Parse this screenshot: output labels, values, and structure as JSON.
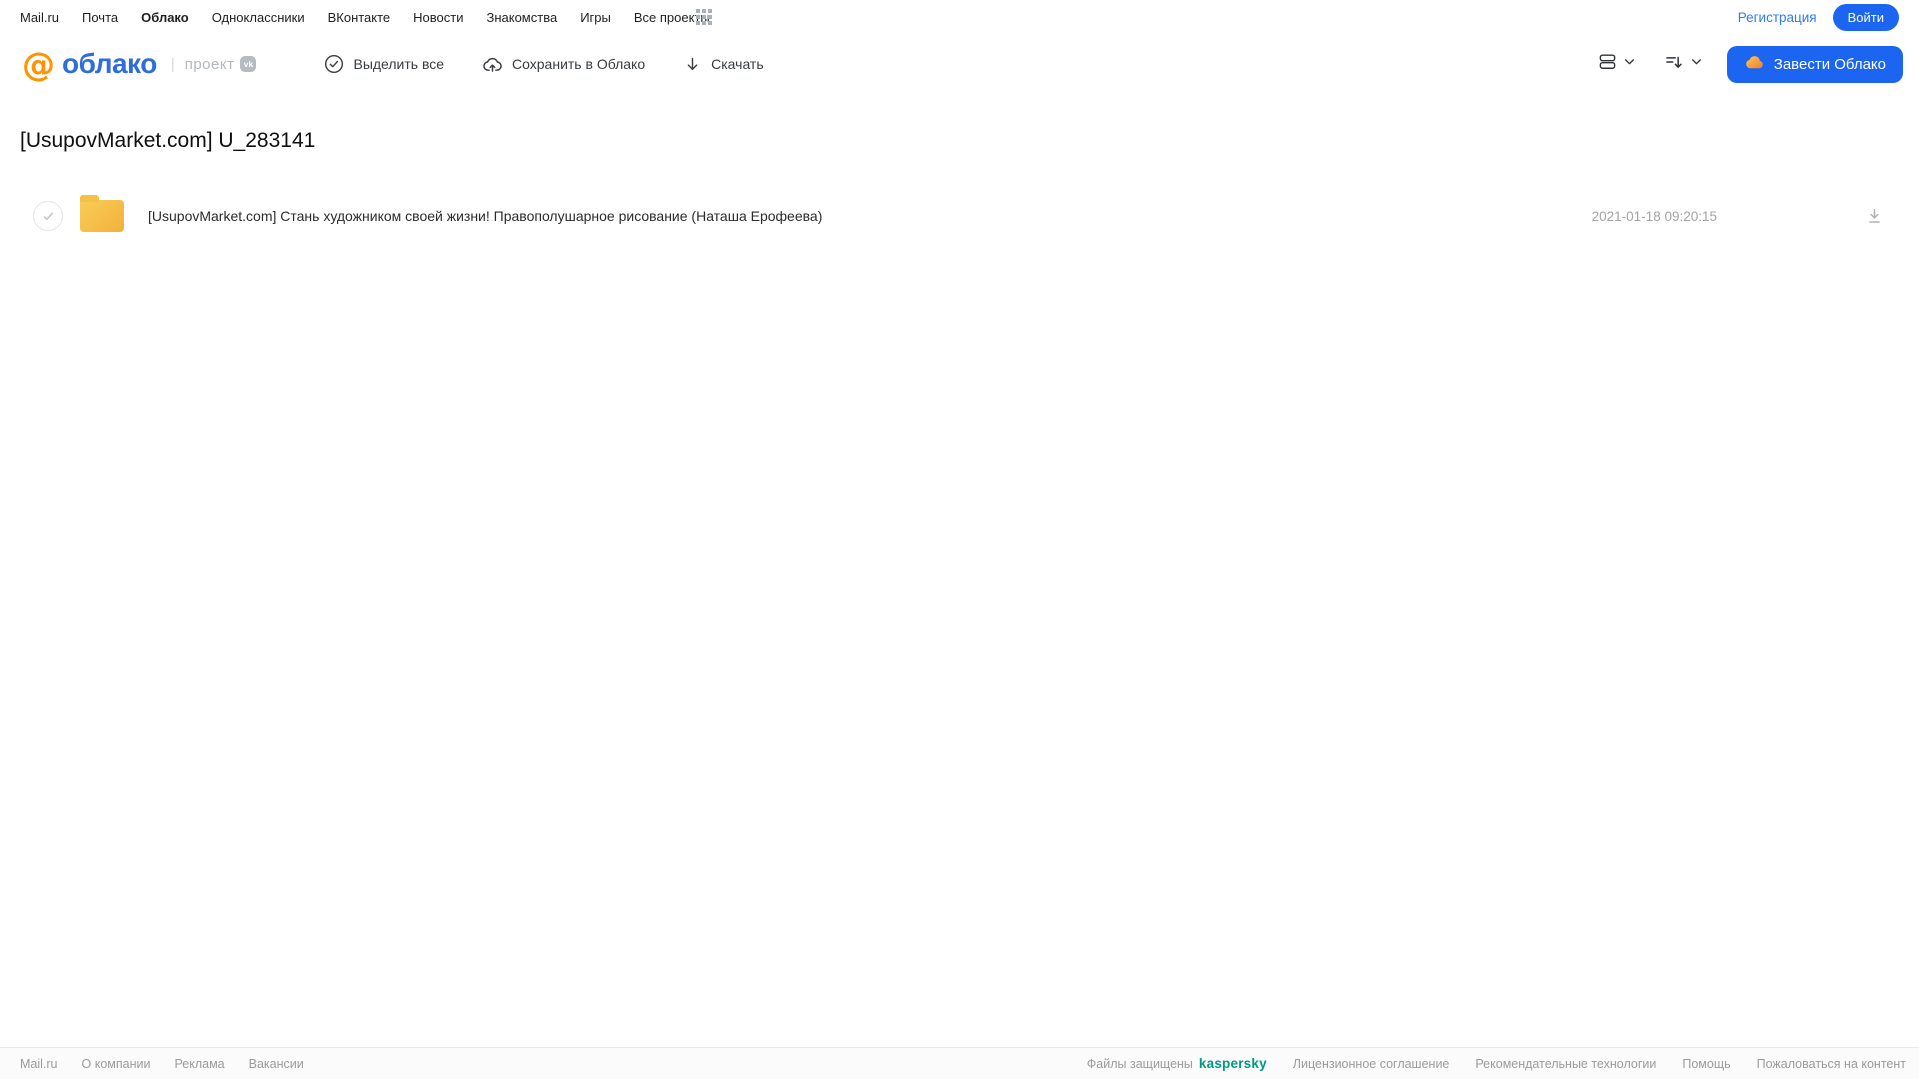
{
  "topnav": {
    "items": [
      "Mail.ru",
      "Почта",
      "Облако",
      "Одноклассники",
      "ВКонтакте",
      "Новости",
      "Знакомства",
      "Игры",
      "Все проекты"
    ],
    "register_label": "Регистрация",
    "login_label": "Войти"
  },
  "header": {
    "logo_at": "@",
    "logo_text": "облако",
    "logo_separator": "|",
    "project_label": "проект",
    "vk_badge_label": "vk",
    "toolbar": {
      "select_all_label": "Выделить все",
      "save_to_cloud_label": "Сохранить в Облако",
      "download_label": "Скачать"
    },
    "get_cloud_button_label": "Завести Облако"
  },
  "main": {
    "title": "[UsupovMarket.com] U_283141",
    "files": [
      {
        "name": "[UsupovMarket.com] Стань художником своей жизни! Правополушарное рисование (Наташа Ерофеева)",
        "date": "2021-01-18 09:20:15"
      }
    ]
  },
  "footer": {
    "left_links": [
      "Mail.ru",
      "О компании",
      "Реклама",
      "Вакансии"
    ],
    "protected_label": "Файлы защищены",
    "kaspersky_label": "kaspersky",
    "right_links": [
      "Лицензионное соглашение",
      "Рекомендательные технологии",
      "Помощь",
      "Пожаловаться на контент"
    ]
  },
  "colors": {
    "accent_blue": "#1b65f1",
    "link_blue": "#2b7cf6",
    "logo_blue": "#2f6ed8",
    "logo_orange": "#ff9400",
    "folder_yellow": "#f5c043",
    "kaspersky_green": "#009982"
  }
}
